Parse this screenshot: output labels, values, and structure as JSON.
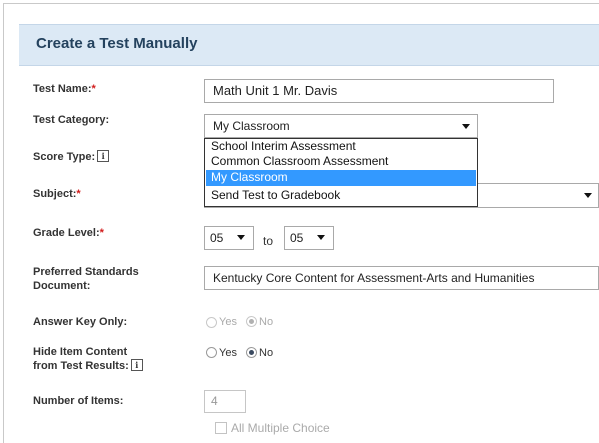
{
  "header": {
    "title": "Create a Test Manually"
  },
  "fields": {
    "test_name": {
      "label": "Test Name:",
      "required_mark": "*",
      "value": "Math Unit 1 Mr. Davis"
    },
    "test_category": {
      "label": "Test Category:",
      "value": "My Classroom",
      "options": [
        "School Interim Assessment",
        "Common Classroom Assessment",
        "My Classroom",
        "Send Test to Gradebook"
      ],
      "highlighted_option": "My Classroom"
    },
    "score_type": {
      "label": "Score Type:",
      "info_icon": "i"
    },
    "subject": {
      "label": "Subject:",
      "required_mark": "*"
    },
    "grade_level": {
      "label": "Grade Level:",
      "required_mark": "*",
      "from": "05",
      "to_word": "to",
      "to": "05"
    },
    "preferred_standards": {
      "label_line1": "Preferred Standards",
      "label_line2": "Document:",
      "value": "Kentucky Core Content for Assessment-Arts and Humanities"
    },
    "answer_key_only": {
      "label": "Answer Key Only:",
      "yes": "Yes",
      "no": "No",
      "selected": "No",
      "disabled": true
    },
    "hide_item_content": {
      "label_line1": "Hide Item Content",
      "label_line2": "from Test Results:",
      "info_icon": "i",
      "yes": "Yes",
      "no": "No",
      "selected": "No"
    },
    "number_of_items": {
      "label": "Number of Items:",
      "value": "4",
      "checkbox_label": "All Multiple Choice"
    }
  },
  "colors": {
    "header_band": "#dce9f5",
    "title_text": "#24425e",
    "required": "#d21c1c",
    "dropdown_highlight": "#3399ff"
  },
  "icons": [
    "info-icon",
    "chevron-down-icon"
  ]
}
